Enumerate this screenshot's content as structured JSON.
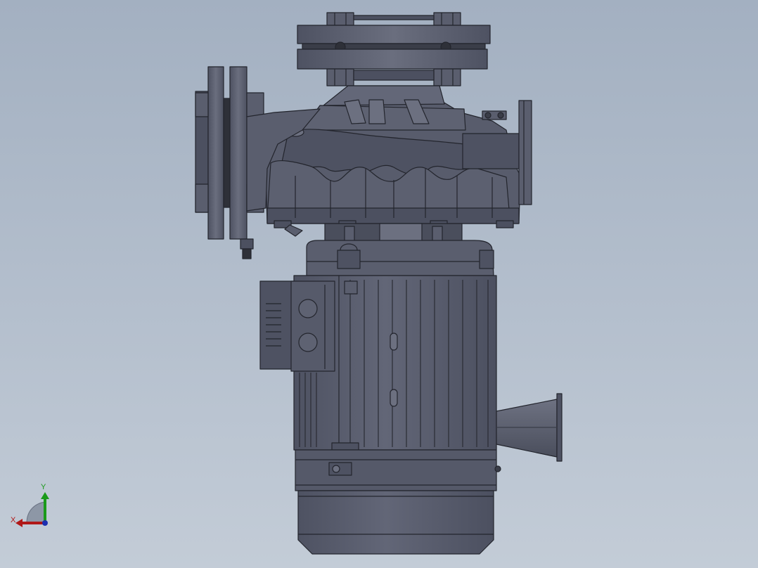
{
  "viewport": {
    "background_top": "#a3b0c1",
    "background_bottom": "#c3ccd7"
  },
  "model": {
    "body_color": "#5a5e6e",
    "shade_color": "#4a4e5c",
    "highlight_color": "#6c7080",
    "edge_color": "#23252d"
  },
  "triad": {
    "x_label": "X",
    "y_label": "Y",
    "x_color": "#b01818",
    "y_color": "#1a9a1a",
    "z_color": "#1c2fb0"
  }
}
